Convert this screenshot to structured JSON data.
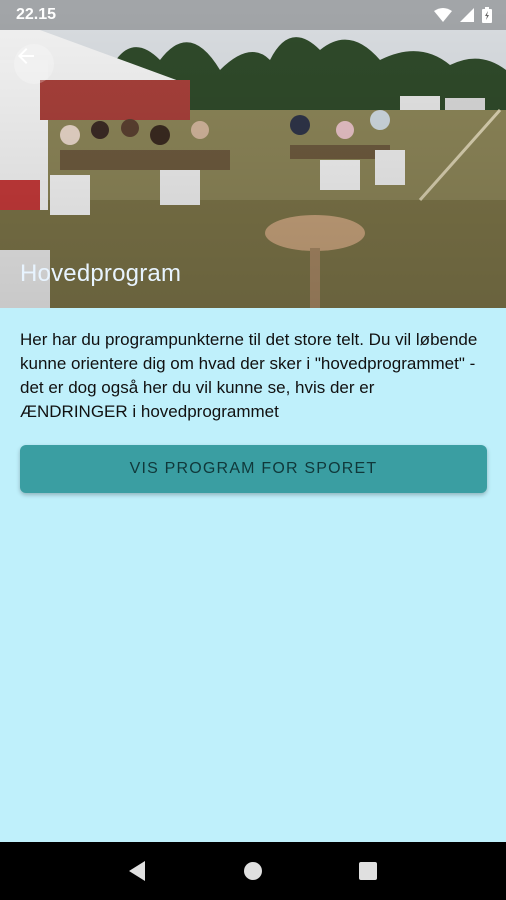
{
  "status_bar": {
    "time": "22.15",
    "icons": [
      "wifi-icon",
      "signal-icon",
      "battery-icon"
    ]
  },
  "hero": {
    "title": "Hovedprogram",
    "image": "outdoor tent event with people seated at tables on a field",
    "back_icon": "arrow-back-icon"
  },
  "main": {
    "description": "Her har du programpunkterne til det store telt. Du vil løbende kunne orientere dig om hvad der sker i \"hovedprogrammet\" - det er dog også her du vil kunne se, hvis der er ÆNDRINGER i hovedprogrammet",
    "button_label": "VIS PROGRAM FOR SPORET"
  },
  "nav_bar": {
    "buttons": [
      "back-triangle-icon",
      "home-circle-icon",
      "recents-square-icon"
    ]
  },
  "colors": {
    "background": "#bff0fb",
    "button": "#3a9ea2",
    "button_text": "#10383a",
    "nav_bar": "#000000"
  }
}
